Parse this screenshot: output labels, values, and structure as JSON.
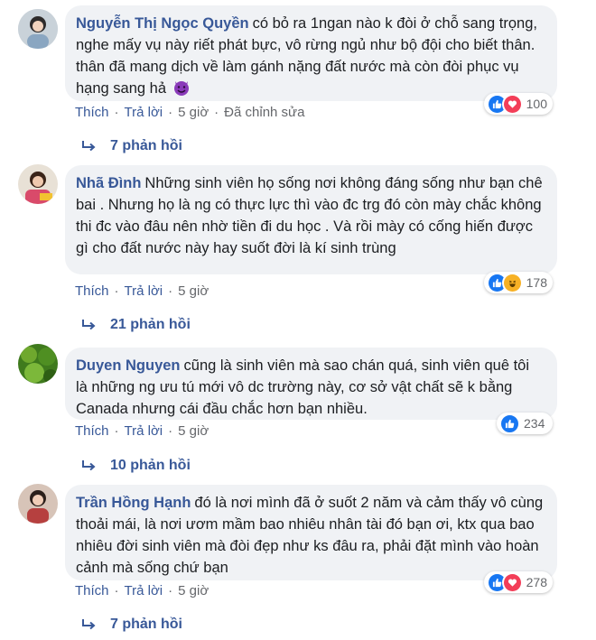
{
  "comments": [
    {
      "author": "Nguyễn Thị Ngọc Quyền",
      "text": "có bỏ ra 1ngan nào k đòi ở chỗ sang trọng, nghe mấy vụ này riết phát bực, vô rừng ngủ như bộ đội cho biết thân. thân đã mang dịch về làm gánh nặng đất nước mà còn đòi phục vụ hạng sang hả",
      "emoji": "smiling-devil-emoji",
      "reactions": [
        "like",
        "love"
      ],
      "reaction_count": "100",
      "like_label": "Thích",
      "reply_label": "Trả lời",
      "time": "5 giờ",
      "edited": "Đã chỉnh sửa",
      "replies_label": "7 phản hồi"
    },
    {
      "author": "Nhã Đình",
      "text": "Những sinh viên họ sống nơi không đáng sống như bạn chê bai . Nhưng họ là ng có thực lực thì vào đc trg đó còn mày chắc không thi đc vào đâu nên nhờ tiền đi du học . Và rồi mày có cống hiến được gì cho đất nước này hay suốt đời là kí sinh trùng",
      "reactions": [
        "like",
        "haha"
      ],
      "reaction_count": "178",
      "like_label": "Thích",
      "reply_label": "Trả lời",
      "time": "5 giờ",
      "replies_label": "21 phản hồi"
    },
    {
      "author": "Duyen Nguyen",
      "text": "cũng là sinh viên mà sao chán quá, sinh viên quê tôi là những ng ưu tú mới vô dc trường này, cơ sở vật chất sẽ k bằng Canada nhưng cái đầu chắc hơn bạn nhiều.",
      "reactions": [
        "like"
      ],
      "reaction_count": "234",
      "like_label": "Thích",
      "reply_label": "Trả lời",
      "time": "5 giờ",
      "replies_label": "10 phản hồi"
    },
    {
      "author": "Trần Hồng Hạnh",
      "text": "đó là nơi mình đã ở suốt 2 năm và cảm thấy vô cùng thoải mái, là nơi ươm mầm bao nhiêu nhân tài đó bạn ơi, ktx qua bao nhiêu đời sinh viên mà đòi đẹp như ks đâu ra, phải đặt mình vào hoàn cảnh mà sống chứ bạn",
      "reactions": [
        "like",
        "love"
      ],
      "reaction_count": "278",
      "like_label": "Thích",
      "reply_label": "Trả lời",
      "time": "5 giờ",
      "replies_label": "7 phản hồi"
    }
  ],
  "colors": {
    "name": "#385898",
    "bubble": "#f0f2f5",
    "meta": "#65676b",
    "like": "#1877f2",
    "love": "#f33e58",
    "haha": "#f7b125"
  }
}
